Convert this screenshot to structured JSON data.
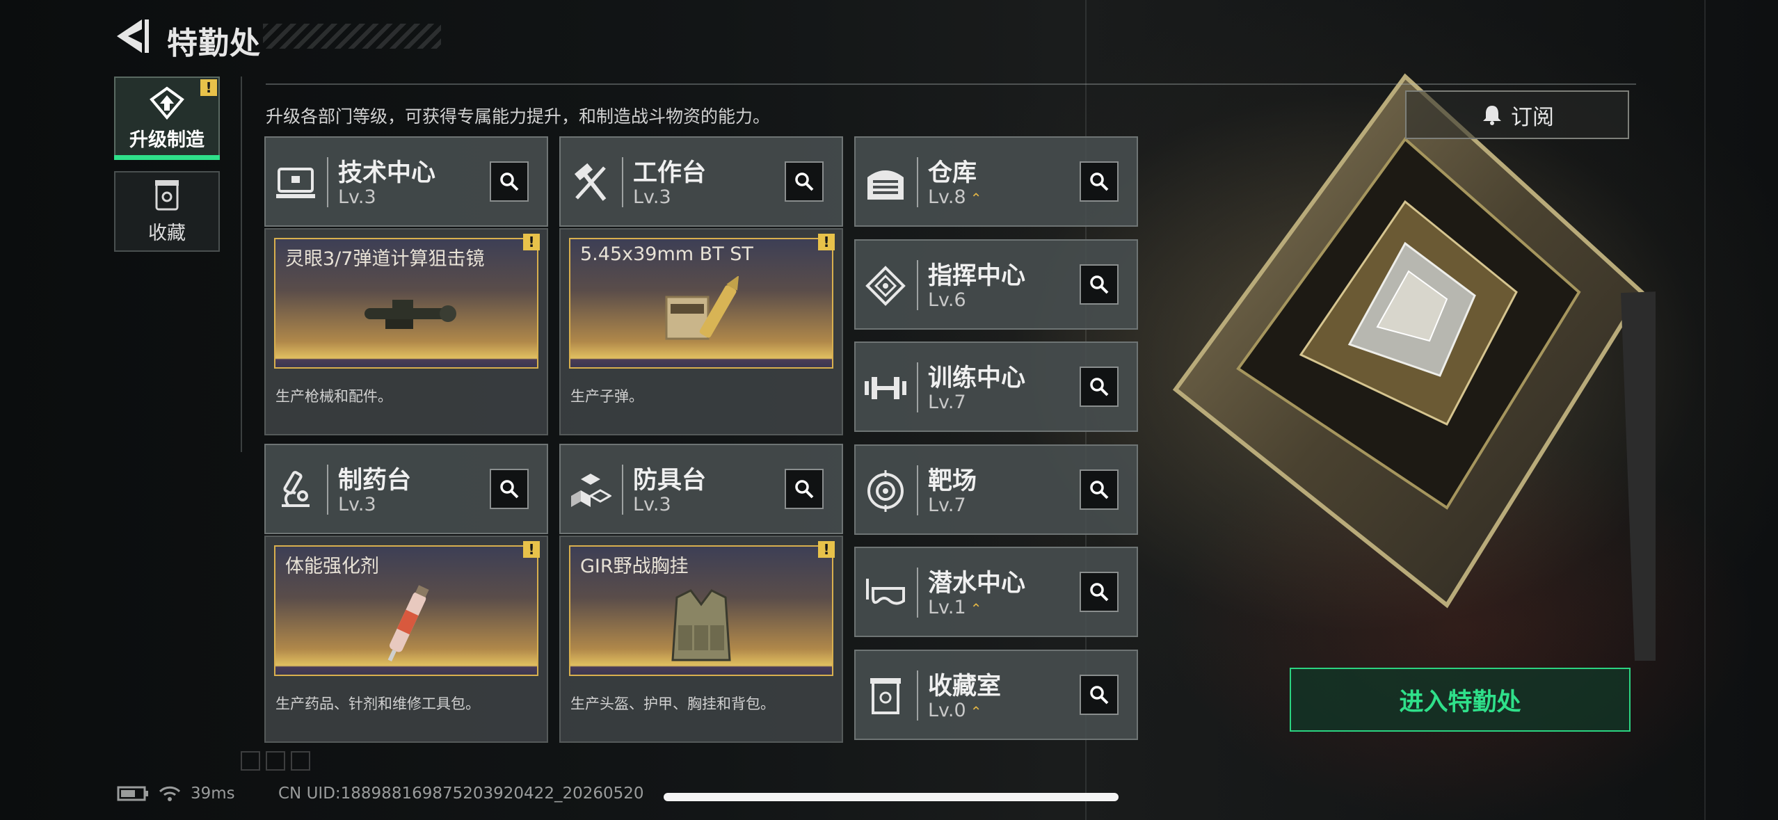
{
  "header": {
    "title": "特勤处"
  },
  "sidebar": [
    {
      "label": "升级制造",
      "active": true,
      "alert": "!"
    },
    {
      "label": "收藏",
      "active": false
    }
  ],
  "description": "升级各部门等级，可获得专属能力提升，和制造战斗物资的能力。",
  "departments": [
    {
      "name": "技术中心",
      "level": "Lv.3",
      "icon": "tech-center-icon"
    },
    {
      "name": "工作台",
      "level": "Lv.3",
      "icon": "workbench-icon"
    },
    {
      "name": "制药台",
      "level": "Lv.3",
      "icon": "pharmacy-icon"
    },
    {
      "name": "防具台",
      "level": "Lv.3",
      "icon": "armor-bench-icon"
    }
  ],
  "productions": [
    {
      "item": "灵眼3/7弹道计算狙击镜",
      "caption": "生产枪械和配件。",
      "alert": "!",
      "icon": "scope-icon"
    },
    {
      "item": "5.45x39mm BT ST",
      "caption": "生产子弹。",
      "alert": "!",
      "icon": "ammo-icon"
    },
    {
      "item": "体能强化剂",
      "caption": "生产药品、针剂和维修工具包。",
      "alert": "!",
      "icon": "injector-icon"
    },
    {
      "item": "GIR野战胸挂",
      "caption": "生产头盔、护甲、胸挂和背包。",
      "alert": "!",
      "icon": "chest-rig-icon"
    }
  ],
  "facilities": [
    {
      "name": "仓库",
      "level": "Lv.8",
      "upgradable": true,
      "upgrade_mark": "⌃",
      "icon": "warehouse-icon"
    },
    {
      "name": "指挥中心",
      "level": "Lv.6",
      "upgradable": false,
      "icon": "command-center-icon"
    },
    {
      "name": "训练中心",
      "level": "Lv.7",
      "upgradable": false,
      "icon": "dumbbell-icon"
    },
    {
      "name": "靶场",
      "level": "Lv.7",
      "upgradable": false,
      "icon": "target-icon"
    },
    {
      "name": "潜水中心",
      "level": "Lv.1",
      "upgradable": true,
      "upgrade_mark": "⌃",
      "icon": "diving-mask-icon"
    },
    {
      "name": "收藏室",
      "level": "Lv.0",
      "upgradable": true,
      "upgrade_mark": "⌃",
      "icon": "collection-icon"
    }
  ],
  "subscribe_label": "订阅",
  "enter_label": "进入特勤处",
  "footer": {
    "ping": "39ms",
    "uid": "CN UID:188988169875203920422_20260520"
  },
  "colors": {
    "accent": "#2fe08a",
    "alert": "#e8c24a",
    "upgrade": "#e0b445",
    "product_border": "#d9b04e"
  }
}
